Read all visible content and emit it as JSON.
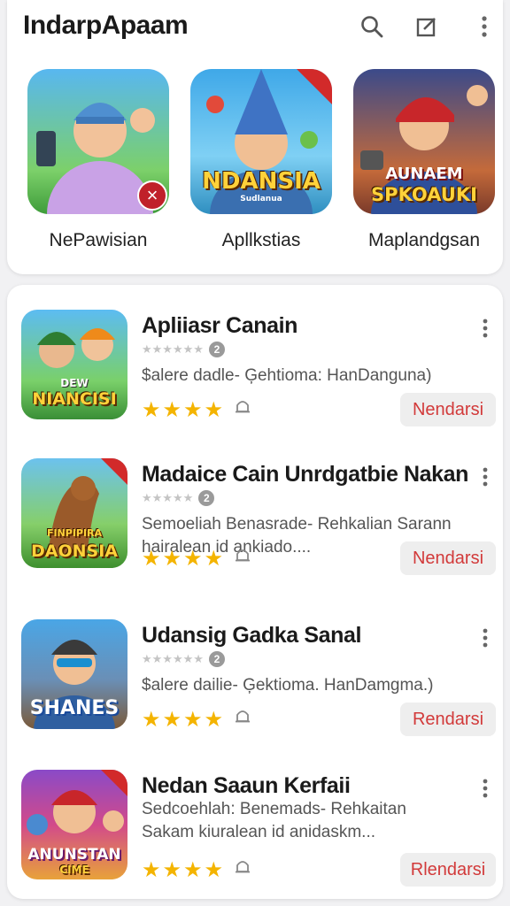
{
  "header": {
    "title": "IndarpApaam",
    "icons": [
      "search-icon",
      "edit-icon",
      "more-vertical-icon"
    ]
  },
  "featured": [
    {
      "label": "NePawisian",
      "badge": "×"
    },
    {
      "label": "Apllkstias",
      "thumb_text": "NDANSIA",
      "thumb_subtext": "Sudlanua"
    },
    {
      "label": "Maplandgsan",
      "thumb_text_1": "AUNAEM",
      "thumb_text_2": "SPKOAUKI"
    }
  ],
  "apps": [
    {
      "title": "Apliiasr Canain",
      "rating_count": "2",
      "description": "$alere dadle- Ģehtioma: HanDanguna)",
      "thumb_text": "NIANCISI",
      "thumb_subtext": "DEW",
      "stars": 4,
      "install_label": "Nendarsi"
    },
    {
      "title": "Madaice Cain Unrdgatbie Nakan",
      "rating_count": "2",
      "description": "Semoeliah Benasrade- Rehkalian Sarann hairalean id ankiado....",
      "thumb_text": "DAONSIA",
      "thumb_subtext": "FINPIPIRA",
      "stars": 4,
      "install_label": "Nendarsi"
    },
    {
      "title": "Udansig Gadka Sanal",
      "rating_count": "2",
      "description": "$alere dailie- Ģektioma. HanDamgma.)",
      "thumb_text": "SHANES",
      "stars": 4,
      "install_label": "Rendarsi"
    },
    {
      "title": "Nedan Saaun Kerfaii",
      "rating_count": "",
      "description": "Sedcoehlah: Benemads- Rehkaitan Sakam kiuralean id anidaskm...",
      "thumb_text": "ANUNSTAN",
      "thumb_subtext": "CIME",
      "stars": 4,
      "install_label": "Rlendarsi"
    }
  ],
  "colors": {
    "star": "#f4b400",
    "install_text": "#d23a3a",
    "install_bg": "#eeeeee",
    "badge_red": "#c0202a"
  }
}
